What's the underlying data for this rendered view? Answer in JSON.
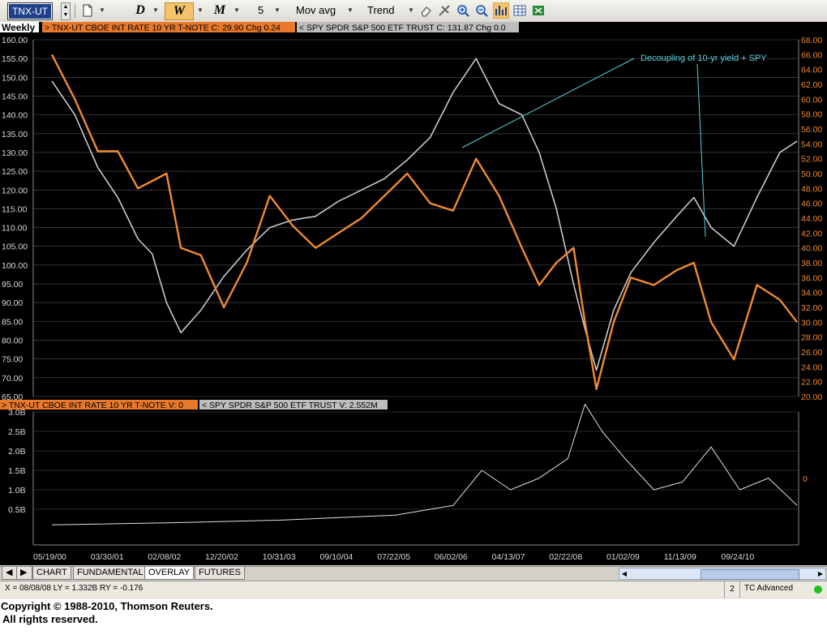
{
  "toolbar": {
    "symbol": "TNX-UT",
    "period_daily": "D",
    "period_weekly": "W",
    "period_monthly": "M",
    "ma_length": "5",
    "ma_type": "Mov avg",
    "trend": "Trend"
  },
  "chart": {
    "interval": "Weekly",
    "price_legend_1": "TNX-UT  CBOE INT RATE 10 YR T-NOTE  C: 29.90  Chg 0.24",
    "price_legend_2": "SPY  SPDR S&P 500 ETF TRUST  C: 131.87  Chg 0.0",
    "volume_legend_1": "TNX-UT  CBOE INT RATE 10 YR T-NOTE  V: 0",
    "volume_legend_2": "SPY  SPDR S&P 500 ETF TRUST  V: 2.552M",
    "annotation": "Decoupling of 10-yr yield + SPY",
    "volume_zero_label": "0",
    "left_axis_ticks": [
      "160.00",
      "155.00",
      "150.00",
      "145.00",
      "140.00",
      "135.00",
      "130.00",
      "125.00",
      "120.00",
      "115.00",
      "110.00",
      "105.00",
      "100.00",
      "95.00",
      "90.00",
      "85.00",
      "80.00",
      "75.00",
      "70.00",
      "65.00"
    ],
    "right_axis_ticks": [
      "68.00",
      "66.00",
      "64.00",
      "62.00",
      "60.00",
      "58.00",
      "56.00",
      "54.00",
      "52.00",
      "50.00",
      "48.00",
      "46.00",
      "44.00",
      "42.00",
      "40.00",
      "38.00",
      "36.00",
      "34.00",
      "32.00",
      "30.00",
      "28.00",
      "26.00",
      "24.00",
      "22.00",
      "20.00"
    ],
    "volume_ticks": [
      "3.0B",
      "2.5B",
      "2.0B",
      "1.5B",
      "1.0B",
      "0.5B"
    ],
    "date_ticks": [
      "05/19/00",
      "03/30/01",
      "02/08/02",
      "12/20/02",
      "10/31/03",
      "09/10/04",
      "07/22/05",
      "06/02/06",
      "04/13/07",
      "02/22/08",
      "01/02/09",
      "11/13/09",
      "09/24/10"
    ],
    "colors": {
      "spy": "#c8c8c8",
      "tnx": "#f08a30",
      "grid": "#555555",
      "annotation": "#5ad0e0"
    }
  },
  "chart_data": {
    "type": "line",
    "x": [
      "05/19/00",
      "03/30/01",
      "02/08/02",
      "12/20/02",
      "10/31/03",
      "09/10/04",
      "07/22/05",
      "06/02/06",
      "04/13/07",
      "02/22/08",
      "01/02/09",
      "11/13/09",
      "09/24/10"
    ],
    "series": [
      {
        "name": "SPY  SPDR S&P 500 ETF TRUST",
        "axis": "left",
        "points": [
          [
            0,
            149
          ],
          [
            0.4,
            140
          ],
          [
            0.8,
            126
          ],
          [
            1.15,
            118
          ],
          [
            1.5,
            107
          ],
          [
            1.75,
            103
          ],
          [
            2.0,
            90
          ],
          [
            2.25,
            82
          ],
          [
            2.6,
            88
          ],
          [
            3.0,
            97
          ],
          [
            3.4,
            104
          ],
          [
            3.8,
            110
          ],
          [
            4.2,
            112
          ],
          [
            4.6,
            113
          ],
          [
            5.0,
            117
          ],
          [
            5.4,
            120
          ],
          [
            5.8,
            123
          ],
          [
            6.2,
            128
          ],
          [
            6.6,
            134
          ],
          [
            7.0,
            146
          ],
          [
            7.4,
            155
          ],
          [
            7.8,
            143
          ],
          [
            8.2,
            140
          ],
          [
            8.5,
            130
          ],
          [
            8.8,
            115
          ],
          [
            9.1,
            95
          ],
          [
            9.3,
            83
          ],
          [
            9.5,
            72
          ],
          [
            9.8,
            88
          ],
          [
            10.1,
            98
          ],
          [
            10.5,
            106
          ],
          [
            10.9,
            113
          ],
          [
            11.2,
            118
          ],
          [
            11.5,
            110
          ],
          [
            11.9,
            105
          ],
          [
            12.3,
            118
          ],
          [
            12.7,
            130
          ],
          [
            13.0,
            133
          ]
        ]
      },
      {
        "name": "TNX-UT  CBOE INT RATE 10 YR T-NOTE",
        "axis": "right",
        "points": [
          [
            0,
            66
          ],
          [
            0.4,
            60
          ],
          [
            0.8,
            53
          ],
          [
            1.15,
            53
          ],
          [
            1.5,
            48
          ],
          [
            2.0,
            50
          ],
          [
            2.25,
            40
          ],
          [
            2.6,
            39
          ],
          [
            3.0,
            32
          ],
          [
            3.4,
            38
          ],
          [
            3.8,
            47
          ],
          [
            4.2,
            43
          ],
          [
            4.6,
            40
          ],
          [
            5.0,
            42
          ],
          [
            5.4,
            44
          ],
          [
            5.8,
            47
          ],
          [
            6.2,
            50
          ],
          [
            6.6,
            46
          ],
          [
            7.0,
            45
          ],
          [
            7.4,
            52
          ],
          [
            7.8,
            47
          ],
          [
            8.2,
            40
          ],
          [
            8.5,
            35
          ],
          [
            8.8,
            38
          ],
          [
            9.1,
            40
          ],
          [
            9.3,
            30
          ],
          [
            9.5,
            21
          ],
          [
            9.8,
            30
          ],
          [
            10.1,
            36
          ],
          [
            10.5,
            35
          ],
          [
            10.9,
            37
          ],
          [
            11.2,
            38
          ],
          [
            11.5,
            30
          ],
          [
            11.9,
            25
          ],
          [
            12.3,
            35
          ],
          [
            12.7,
            33
          ],
          [
            13.0,
            30
          ]
        ]
      },
      {
        "name": "SPY volume",
        "axis": "volume",
        "points": [
          [
            0,
            0.1
          ],
          [
            2.0,
            0.15
          ],
          [
            4.0,
            0.22
          ],
          [
            6.0,
            0.35
          ],
          [
            7.0,
            0.6
          ],
          [
            7.5,
            1.5
          ],
          [
            8.0,
            1.0
          ],
          [
            8.5,
            1.3
          ],
          [
            9.0,
            1.8
          ],
          [
            9.3,
            3.2
          ],
          [
            9.6,
            2.5
          ],
          [
            10.0,
            1.8
          ],
          [
            10.5,
            1.0
          ],
          [
            11.0,
            1.2
          ],
          [
            11.5,
            2.1
          ],
          [
            12.0,
            1.0
          ],
          [
            12.5,
            1.3
          ],
          [
            13.0,
            0.6
          ]
        ]
      }
    ],
    "left_axis_range": [
      65,
      160
    ],
    "right_axis_range": [
      20,
      68
    ],
    "volume_range": [
      0,
      3.0
    ],
    "grid": true
  },
  "tabs": [
    "CHART",
    "FUNDAMENTAL",
    "OVERLAY",
    "FUTURES"
  ],
  "status": {
    "readout": "X = 08/08/08  LY = 1.332B  RY = -0.176",
    "page": "2",
    "profile": "TC Advanced"
  },
  "copyright": {
    "line1": "Copyright © 1988-2010, Thomson Reuters.",
    "line2": "All rights reserved."
  }
}
